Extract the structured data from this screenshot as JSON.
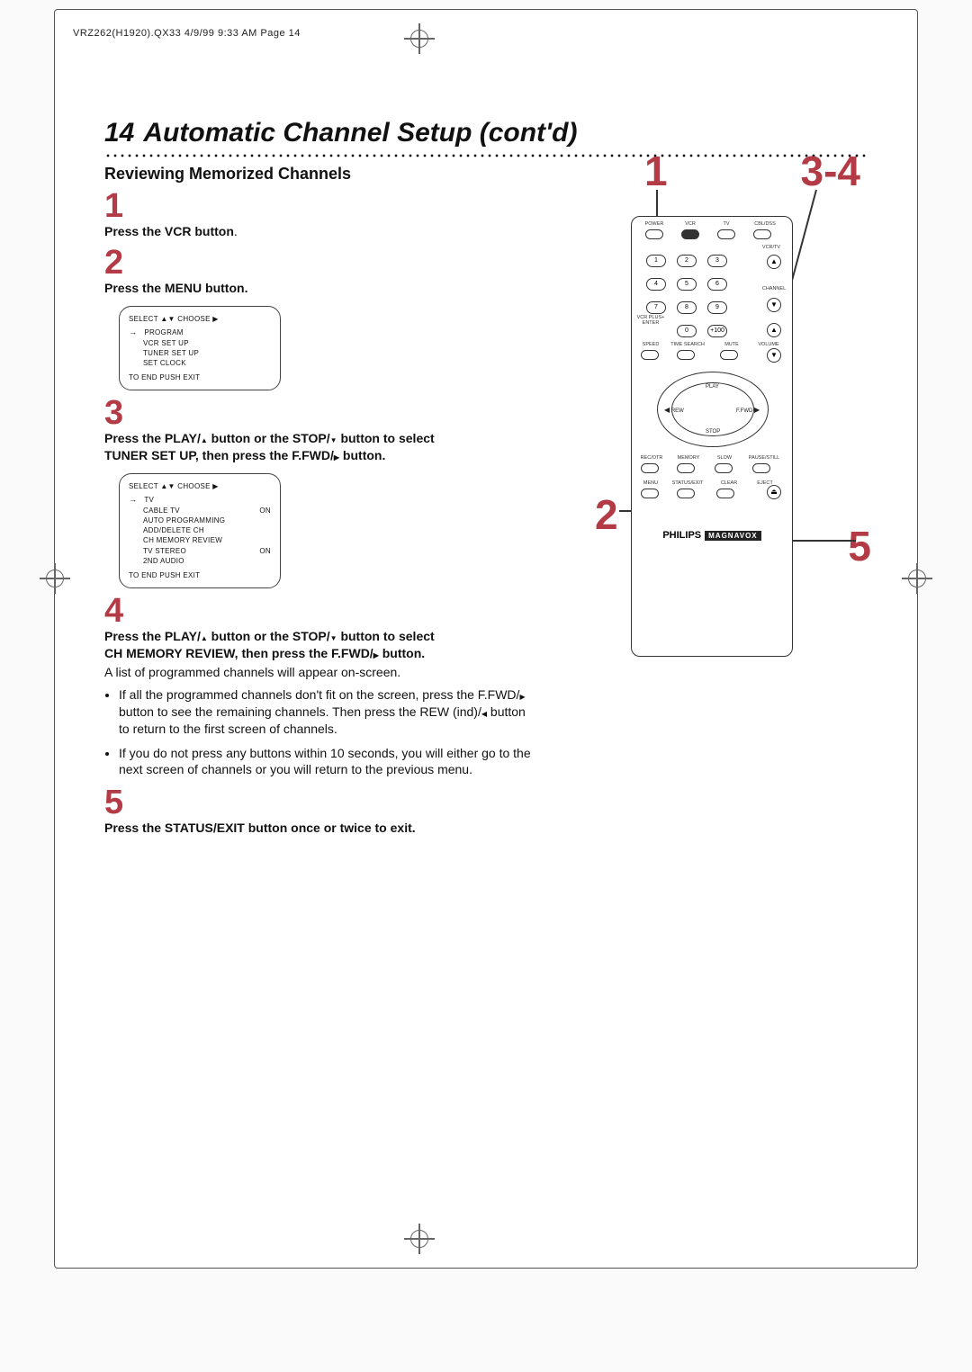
{
  "header_slug": "VRZ262(H1920).QX33  4/9/99 9:33 AM  Page 14",
  "title": {
    "number": "14",
    "text": "Automatic Channel Setup (cont'd)"
  },
  "subheading": "Reviewing Memorized Channels",
  "steps": {
    "s1": {
      "num": "1",
      "text_b": "Press the VCR button",
      "text_after": "."
    },
    "s2": {
      "num": "2",
      "text_b": "Press the MENU button."
    },
    "s3": {
      "num": "3",
      "line1_a": "Press the PLAY/",
      "line1_b": " button or the STOP/",
      "line1_c": " button to select",
      "line2_a": "TUNER SET UP, then press the F.FWD/",
      "line2_b": " button."
    },
    "s4": {
      "num": "4",
      "line1_a": "Press the PLAY/",
      "line1_b": " button or the STOP/",
      "line1_c": " button to select",
      "line2_a": "CH MEMORY REVIEW, then press the F.FWD/",
      "line2_b": " button.",
      "sub": "A list of programmed channels will appear on-screen.",
      "b1a": "If all the programmed channels don't fit on the screen, press the F.FWD/",
      "b1b": " button to see the remaining channels. Then press the REW (ind)/",
      "b1c": " button to return to the first screen of channels.",
      "b2": "If you do not press any buttons within 10 seconds, you will either go to the next screen of channels or you will return to the previous menu."
    },
    "s5": {
      "num": "5",
      "text_b": "Press the STATUS/EXIT button once or twice to exit."
    }
  },
  "osd1": {
    "head_a": "SELECT ",
    "head_b": " CHOOSE ",
    "l1": "PROGRAM",
    "l2": "VCR SET UP",
    "l3": "TUNER SET UP",
    "l4": "SET CLOCK",
    "foot": "TO END PUSH EXIT"
  },
  "osd2": {
    "head_a": "SELECT ",
    "head_b": " CHOOSE ",
    "l1": "TV",
    "l2a": "CABLE TV",
    "l2b": "ON",
    "l3": "AUTO PROGRAMMING",
    "l4": "ADD/DELETE CH",
    "l5": "CH MEMORY REVIEW",
    "l6a": "TV STEREO",
    "l6b": "ON",
    "l7": "2ND AUDIO",
    "foot": "TO END PUSH EXIT"
  },
  "callouts": {
    "c1": "1",
    "c34": "3-4",
    "c2": "2",
    "c5": "5"
  },
  "remote": {
    "row1": [
      "POWER",
      "VCR",
      "TV",
      "CBL/DSS"
    ],
    "vcrtv": "VCR/TV",
    "channel": "CHANNEL",
    "vcrplus": "VCR PLUS+\nENTER",
    "plus100": "+100",
    "row_small": [
      "SPEED",
      "TIME SEARCH",
      "MUTE",
      "VOLUME"
    ],
    "ring": {
      "play": "PLAY",
      "rew": "REW",
      "ffwd": "F.FWD",
      "stop": "STOP"
    },
    "row_small2": [
      "REC/OTR",
      "MEMORY",
      "SLOW",
      "PAUSE/STILL"
    ],
    "row_small3": [
      "MENU",
      "STATUS/EXIT",
      "CLEAR",
      "EJECT"
    ],
    "brand_a": "PHILIPS",
    "brand_b": "MAGNAVOX",
    "num": [
      "1",
      "2",
      "3",
      "4",
      "5",
      "6",
      "7",
      "8",
      "9",
      "0"
    ]
  }
}
